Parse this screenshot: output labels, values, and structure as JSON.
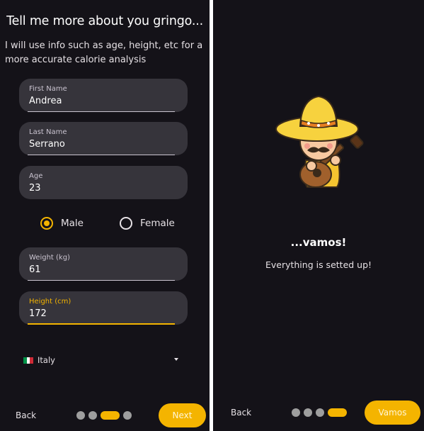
{
  "profile": {
    "title": "Tell me more about you gringo...",
    "subtitle": "I will use info such as age, height, etc for a more accurate calorie analysis",
    "fields": [
      {
        "label": "First Name",
        "value": "Andrea"
      },
      {
        "label": "Last Name",
        "value": "Serrano"
      },
      {
        "label": "Age",
        "value": "23"
      },
      {
        "label": "Weight (kg)",
        "value": "61"
      },
      {
        "label": "Height (cm)",
        "value": "172"
      }
    ],
    "gender": {
      "options": [
        "Male",
        "Female"
      ],
      "selected": "Male"
    },
    "country": {
      "name": "Italy",
      "flag_colors": [
        "#009246",
        "#ffffff",
        "#ce2b37"
      ]
    },
    "back_label": "Back",
    "next_label": "Next",
    "step": {
      "current": 3,
      "total": 4
    }
  },
  "done": {
    "heading": "...vamos!",
    "message": "Everything is setted up!",
    "back_label": "Back",
    "primary_label": "Vamos",
    "step": {
      "current": 4,
      "total": 4
    },
    "illustration": "mariachi-mascot-with-guitar"
  },
  "colors": {
    "accent": "#f4b400",
    "background": "#141218",
    "field": "#36343b"
  }
}
